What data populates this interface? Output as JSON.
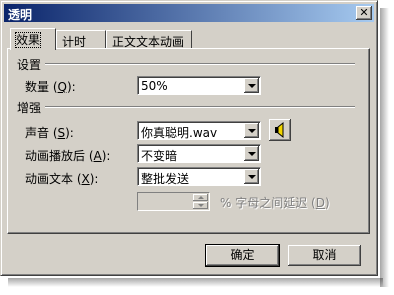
{
  "window": {
    "title": "透明",
    "close_glyph": "✕"
  },
  "tabs": [
    {
      "label": "效果",
      "active": true
    },
    {
      "label": "计时",
      "active": false
    },
    {
      "label": "正文文本动画",
      "active": false
    }
  ],
  "settings_section": {
    "title": "设置",
    "quantity": {
      "label_prefix": "数量 (",
      "accel": "Q",
      "label_suffix": "):",
      "value": "50%"
    }
  },
  "enhance_section": {
    "title": "增强",
    "sound": {
      "label_prefix": "声音 (",
      "accel": "S",
      "label_suffix": "):",
      "value": "你真聪明.wav"
    },
    "after_animation": {
      "label_prefix": "动画播放后 (",
      "accel": "A",
      "label_suffix": "):",
      "value": "不变暗"
    },
    "animate_text": {
      "label_prefix": "动画文本 (",
      "accel": "X",
      "label_suffix": "):",
      "value": "整批发送"
    },
    "delay_label_prefix": "% 字母之间延迟 (",
    "delay_accel": "D",
    "delay_label_suffix": ")"
  },
  "buttons": {
    "ok": "确定",
    "cancel": "取消"
  },
  "colors": {
    "face": "#d4d0c8",
    "title_start": "#0a246a",
    "title_end": "#a6caf0"
  }
}
